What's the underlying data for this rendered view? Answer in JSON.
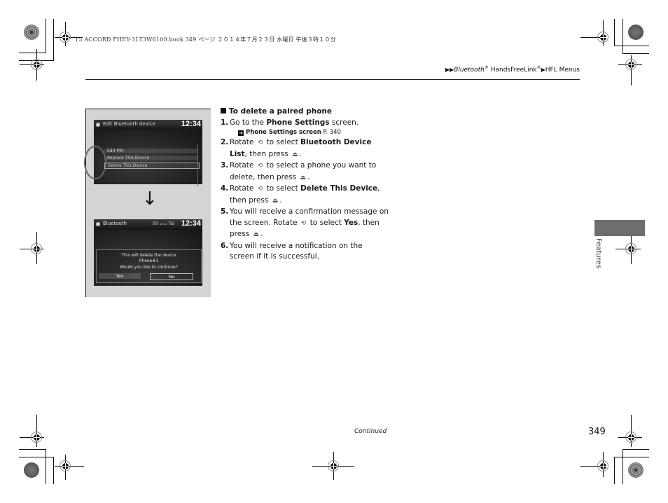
{
  "print_header": {
    "text": "15 ACCORD FHEY-31T3W6100.book  349 ページ  ２０１４年７月２３日  水曜日  午後３時１０分"
  },
  "breadcrumb": {
    "arrow": "▶▶",
    "part1": "Bluetooth",
    "reg": "®",
    "part2": " HandsFreeLink",
    "arrow2": "▶",
    "part3": "HFL Menus"
  },
  "screenshot1": {
    "title": "Edit Bluetooth device",
    "time": "12:34",
    "menu_items": [
      "Edit PIN",
      "Replace This Device",
      "Delete This Device"
    ],
    "selected_index": 2
  },
  "screenshot2": {
    "title": "Bluetooth",
    "signal": "50 ▭▭ Tal",
    "time": "12:34",
    "dialog_lines": [
      "This will delete the device",
      "Phone#1",
      "Would you like to continue?"
    ],
    "yes_label": "Yes",
    "no_label": "No"
  },
  "arrow_glyph": "↓",
  "section": {
    "heading": "To delete a paired phone",
    "steps": [
      {
        "num": "1.",
        "pre": "Go to the ",
        "bold": "Phone Settings",
        "post": " screen."
      },
      {
        "num": "2.",
        "pre": "Rotate ",
        "mid": " to select ",
        "bold": "Bluetooth Device List",
        "post": ", then press "
      },
      {
        "num": "3.",
        "pre": "Rotate ",
        "mid": " to select a phone you want to delete, then press "
      },
      {
        "num": "4.",
        "pre": "Rotate ",
        "mid": " to select ",
        "bold": "Delete This Device",
        "post": ", then press "
      },
      {
        "num": "5.",
        "pre": "You will receive a confirmation message on the screen. Rotate ",
        "mid": " to select ",
        "bold": "Yes",
        "post": ", then press "
      },
      {
        "num": "6.",
        "pre": "You will receive a notification on the screen if it is successful."
      }
    ],
    "reference": {
      "bold": "Phone Settings screen",
      "page": " P. 340"
    },
    "rotate_icon": "⟲",
    "press_icon": "⏏",
    "period": "."
  },
  "side_tab": {
    "label": "Features"
  },
  "footer": {
    "continued": "Continued",
    "page_number": "349"
  }
}
